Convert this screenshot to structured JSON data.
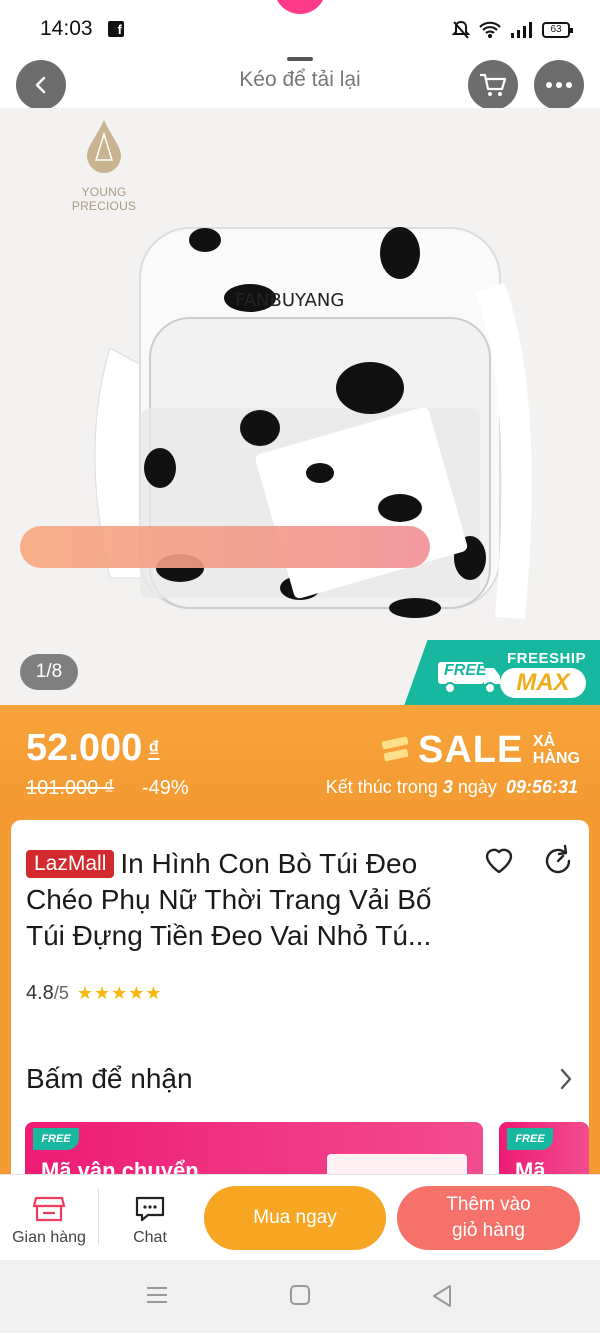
{
  "status_bar": {
    "time": "14:03",
    "battery": "63"
  },
  "nav": {
    "pull_label": "Kéo để tải lại"
  },
  "product_image": {
    "brand_name": "YOUNG PRECIOUS",
    "counter": "1/8",
    "freeship_label": "FREESHIP",
    "freeship_max": "MAX",
    "free_label": "FREE"
  },
  "price": {
    "current": "52.000",
    "currency": "₫",
    "original": "101.000 ₫",
    "discount": "-49%"
  },
  "sale": {
    "word": "SALE",
    "sub_line1": "XẢ",
    "sub_line2": "HÀNG",
    "countdown_prefix": "Kết thúc trong",
    "countdown_days": "3",
    "countdown_unit": "ngày",
    "countdown_time": "09:56:31"
  },
  "product": {
    "badge": "LazMall",
    "title": "In Hình Con Bò Túi Đeo Chéo Phụ Nữ Thời Trang Vải Bố Túi Đựng Tiền Đeo Vai Nhỏ Tú...",
    "rating": "4.8",
    "rating_max": "/5",
    "stars": "★★★★★"
  },
  "claim": {
    "heading": "Bấm để nhận",
    "vouchers": [
      {
        "free_tag": "FREE",
        "title": "Mã vận chuyển"
      },
      {
        "free_tag": "FREE",
        "title": "Mã vận"
      }
    ]
  },
  "bottom_bar": {
    "store_label": "Gian hàng",
    "chat_label": "Chat",
    "buy_now": "Mua ngay",
    "add_to_cart_line1": "Thêm vào",
    "add_to_cart_line2": "giỏ hàng"
  },
  "colors": {
    "price_banner": "#f39a32",
    "buy_now": "#f6a623",
    "add_to_cart": "#f5716a",
    "lazmall": "#d32a2f",
    "freeship": "#17b7a0",
    "voucher": "#ee1b74"
  },
  "icons": {
    "back": "back-arrow-icon",
    "cart": "cart-icon",
    "more": "more-dots-icon",
    "heart": "heart-icon",
    "share": "share-icon",
    "store": "store-icon",
    "chat": "chat-icon"
  }
}
